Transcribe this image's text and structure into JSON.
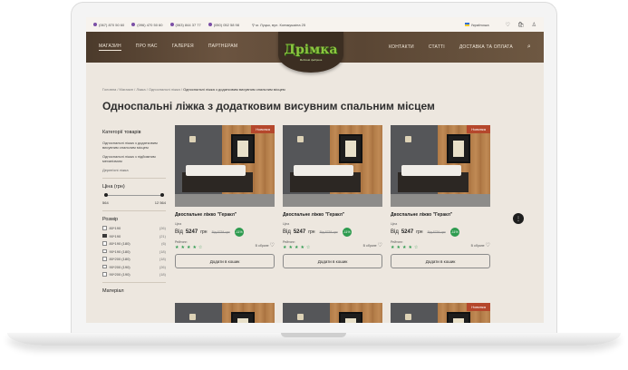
{
  "topbar": {
    "phones": [
      "(067) 870 50 60",
      "(096) 470 50 60",
      "(063) 844 37 77",
      "(050) 052 58 98"
    ],
    "address": "м. Луцьк, вул. Конякушкіна 25",
    "language": "Українська"
  },
  "nav": {
    "left": [
      "Магазин",
      "Про нас",
      "Галерея",
      "Партнерам"
    ],
    "right": [
      "Контакти",
      "Статті",
      "Доставка та оплата"
    ]
  },
  "logo": {
    "title": "Дрімка",
    "slogan": "Меблеві фабрика"
  },
  "breadcrumbs": [
    "Головна",
    "Магазин",
    "Ліжка",
    "Односпальні ліжка",
    "Односпальні ліжка з додатковим висувним спальним місцем"
  ],
  "page_title": "Односпальні ліжка з додатковим висувним спальним місцем",
  "sidebar": {
    "categories_title": "Категорії товарів",
    "categories": [
      "Односпальні ліжка з додатковим висувним спальним місцем",
      "Односпальні ліжка з підйомним механізмом",
      "Дерев'яні ліжка"
    ],
    "price_title": "Ціна (грн)",
    "price_min": "564",
    "price_max": "12 564",
    "size_title": "Розмір",
    "sizes": [
      {
        "label": "80*190",
        "count": "(26)",
        "checked": false
      },
      {
        "label": "90*190",
        "count": "(21)",
        "checked": true
      },
      {
        "label": "80*190 (180)",
        "count": "(6)",
        "checked": false
      },
      {
        "label": "90*190 (180)",
        "count": "(18)",
        "checked": false
      },
      {
        "label": "80*200 (180)",
        "count": "(18)",
        "checked": false
      },
      {
        "label": "90*200 (190)",
        "count": "(26)",
        "checked": false
      },
      {
        "label": "90*200 (190)",
        "count": "(18)",
        "checked": false
      }
    ],
    "material_title": "Матеріал"
  },
  "products": [
    {
      "badge": "Новинка",
      "name": "Двоспальне ліжко \"Геракл\"",
      "price_label": "Ціна",
      "from": "Від",
      "price": "5247",
      "currency": "грн",
      "old_price": "Від 6754 грн",
      "discount": "-11%",
      "reviews_label": "Рейтинг:",
      "stars": "★★★★☆",
      "fav_label": "В обране",
      "button": "Додати в кошик"
    },
    {
      "badge": "",
      "name": "Двоспальне ліжко \"Геракл\"",
      "price_label": "Ціна",
      "from": "Від",
      "price": "5247",
      "currency": "грн",
      "old_price": "Від 6754 грн",
      "discount": "-11%",
      "reviews_label": "Рейтинг:",
      "stars": "★★★★☆",
      "fav_label": "В обране",
      "button": "Додати в кошик"
    },
    {
      "badge": "Новинка",
      "name": "Двоспальне ліжко \"Геракл\"",
      "price_label": "Ціна",
      "from": "Від",
      "price": "5247",
      "currency": "грн",
      "old_price": "Від 6754 грн",
      "discount": "-11%",
      "reviews_label": "Рейтинг:",
      "stars": "★★★★☆",
      "fav_label": "В обране",
      "button": "Додати в кошик"
    },
    {
      "badge": "",
      "name": "",
      "price_label": "",
      "from": "",
      "price": "",
      "currency": "",
      "old_price": "",
      "discount": "",
      "reviews_label": "",
      "stars": "",
      "fav_label": "",
      "button": ""
    },
    {
      "badge": "",
      "name": "",
      "price_label": "",
      "from": "",
      "price": "",
      "currency": "",
      "old_price": "",
      "discount": "",
      "reviews_label": "",
      "stars": "",
      "fav_label": "",
      "button": ""
    },
    {
      "badge": "Новинка",
      "name": "",
      "price_label": "",
      "from": "",
      "price": "",
      "currency": "",
      "old_price": "",
      "discount": "",
      "reviews_label": "",
      "stars": "",
      "fav_label": "",
      "button": ""
    }
  ],
  "icons": {
    "heart": "heart-icon",
    "cart": "cart-icon",
    "user": "user-icon",
    "search": "search-icon",
    "filter": "filter-icon"
  }
}
